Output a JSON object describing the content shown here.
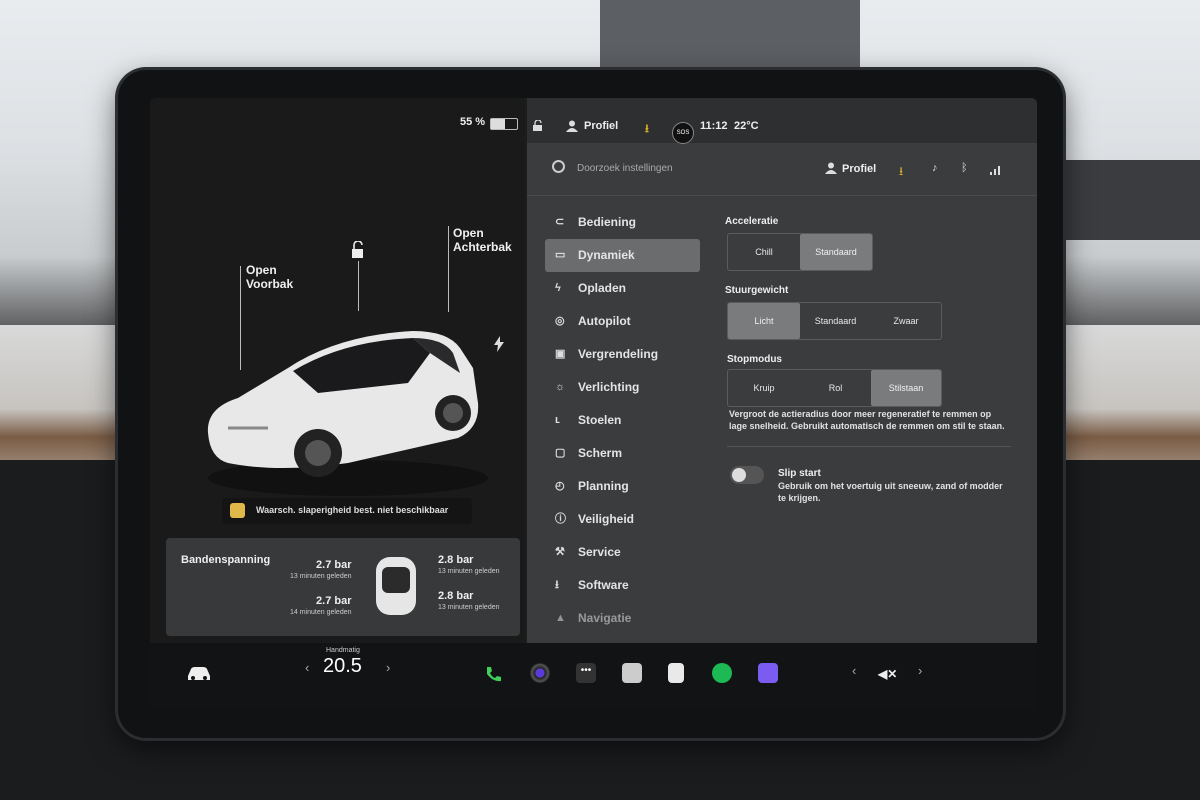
{
  "status": {
    "battery": "55 %",
    "battery_level": 0.55,
    "profile": "Profiel",
    "time": "11:12",
    "temperature": "22°C",
    "sos": "SOS"
  },
  "car": {
    "open_frunk": [
      "Open",
      "Voorbak"
    ],
    "open_trunk": [
      "Open",
      "Achterbak"
    ],
    "warning": "Waarsch. slaperigheid best. niet beschikbaar"
  },
  "tires": {
    "title": "Bandenspanning",
    "front_left": {
      "value": "2.7 bar",
      "age": "13 minuten geleden"
    },
    "front_right": {
      "value": "2.8 bar",
      "age": "13 minuten geleden"
    },
    "rear_left": {
      "value": "2.7 bar",
      "age": "14 minuten geleden"
    },
    "rear_right": {
      "value": "2.8 bar",
      "age": "13 minuten geleden"
    }
  },
  "search": {
    "placeholder": "Doorzoek instellingen",
    "profile": "Profiel"
  },
  "nav": [
    {
      "label": "Bediening",
      "icon": "toggle-icon"
    },
    {
      "label": "Dynamiek",
      "icon": "car-icon"
    },
    {
      "label": "Opladen",
      "icon": "bolt-icon"
    },
    {
      "label": "Autopilot",
      "icon": "steering-wheel-icon"
    },
    {
      "label": "Vergrendeling",
      "icon": "lock-icon"
    },
    {
      "label": "Verlichting",
      "icon": "sun-icon"
    },
    {
      "label": "Stoelen",
      "icon": "seat-icon"
    },
    {
      "label": "Scherm",
      "icon": "screen-icon"
    },
    {
      "label": "Planning",
      "icon": "alarm-icon"
    },
    {
      "label": "Veiligheid",
      "icon": "safety-icon"
    },
    {
      "label": "Service",
      "icon": "wrench-icon"
    },
    {
      "label": "Software",
      "icon": "download-icon"
    },
    {
      "label": "Navigatie",
      "icon": "navigation-icon"
    }
  ],
  "settings": {
    "acceleration": {
      "title": "Acceleratie",
      "options": [
        "Chill",
        "Standaard"
      ],
      "selected": "Standaard"
    },
    "steering": {
      "title": "Stuurgewicht",
      "options": [
        "Licht",
        "Standaard",
        "Zwaar"
      ],
      "selected": "Licht"
    },
    "stop_mode": {
      "title": "Stopmodus",
      "options": [
        "Kruip",
        "Rol",
        "Stilstaan"
      ],
      "selected": "Stilstaan"
    },
    "stop_description": "Vergroot de actieradius door meer regeneratief te remmen op lage snelheid. Gebruikt automatisch de remmen om stil te staan.",
    "slip_start": {
      "title": "Slip start",
      "description": "Gebruik om het voertuig uit sneeuw, zand of modder te krijgen.",
      "enabled": false
    }
  },
  "dock": {
    "climate_mode": "Handmatig",
    "climate_temp": "20.5"
  }
}
